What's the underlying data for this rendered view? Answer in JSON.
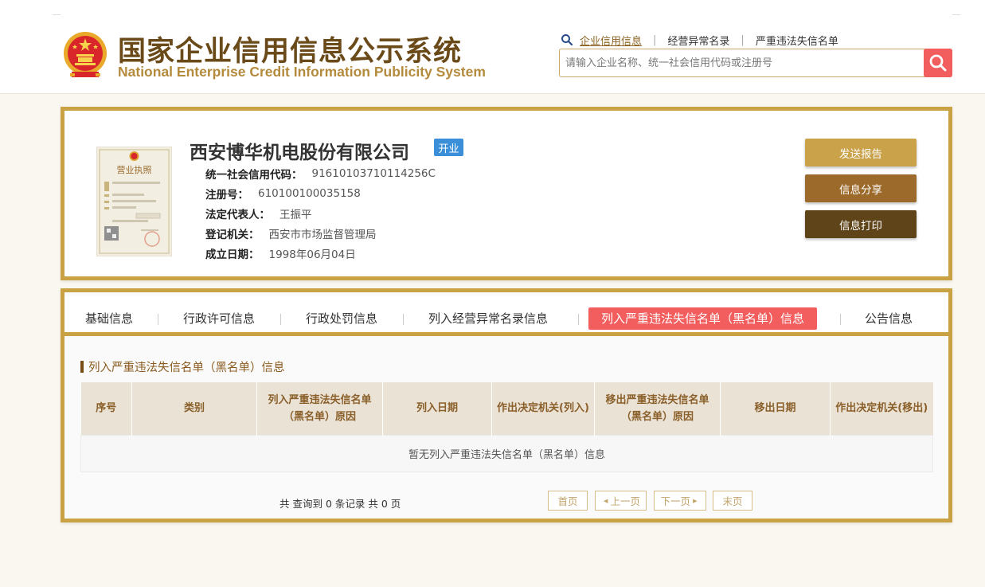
{
  "header": {
    "title_cn": "国家企业信用信息公示系统",
    "title_en": "National Enterprise Credit Information Publicity System",
    "links": [
      "企业信用信息",
      "经营异常名录",
      "严重违法失信名单"
    ],
    "search_placeholder": "请输入企业名称、统一社会信用代码或注册号",
    "search_icon": "search-icon"
  },
  "company": {
    "name": "西安博华机电股份有限公司",
    "status": "开业",
    "license_text": "营业执照",
    "fields": [
      {
        "label": "统一社会信用代码：",
        "value": "91610103710114256C"
      },
      {
        "label": "注册号：",
        "value": "610100100035158"
      },
      {
        "label": "法定代表人：",
        "value": "王振平"
      },
      {
        "label": "登记机关：",
        "value": "西安市市场监督管理局"
      },
      {
        "label": "成立日期：",
        "value": "1998年06月04日"
      }
    ],
    "buttons": [
      "发送报告",
      "信息分享",
      "信息打印"
    ]
  },
  "colors": {
    "accent_gold": "#c9a243",
    "brand_brown": "#6b4a1a",
    "active_red": "#f25d5d",
    "badge_blue": "#3b8fd9",
    "btn_send": "#c9a24a",
    "btn_share": "#9c6a2a",
    "btn_print": "#5e4418"
  },
  "tabs": {
    "items": [
      "基础信息",
      "行政许可信息",
      "行政处罚信息",
      "列入经营异常名录信息",
      "列入严重违法失信名单（黑名单）信息",
      "公告信息"
    ],
    "active_index": 4
  },
  "section": {
    "title": "列入严重违法失信名单（黑名单）信息",
    "columns": [
      "序号",
      "类别",
      "列入严重违法失信名单（黑名单）原因",
      "列入日期",
      "作出决定机关(列入)",
      "移出严重违法失信名单（黑名单）原因",
      "移出日期",
      "作出决定机关(移出)"
    ],
    "empty_text": "暂无列入严重违法失信名单（黑名单）信息"
  },
  "pagination": {
    "summary": "共 查询到 0 条记录 共 0 页",
    "first": "首页",
    "prev": "上一页",
    "next": "下一页",
    "last": "末页"
  }
}
